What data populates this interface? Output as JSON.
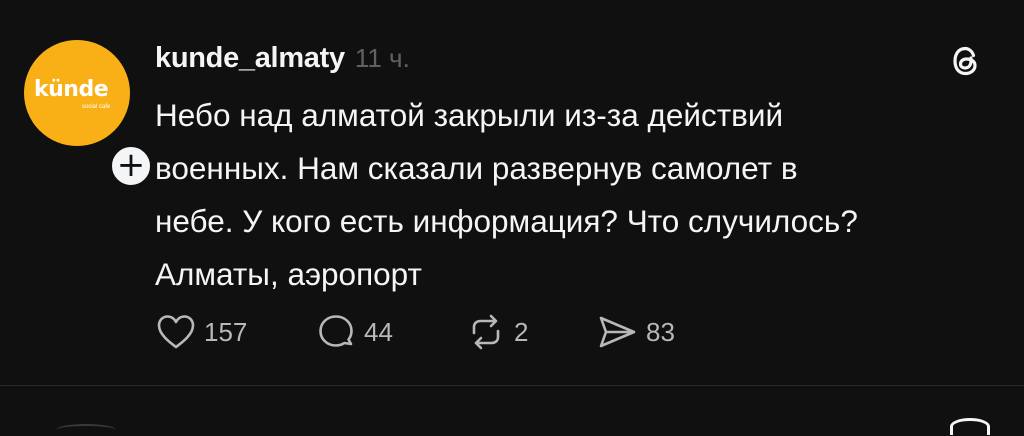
{
  "post": {
    "avatar": {
      "logo_text": "künde",
      "logo_subtext": "social cafe",
      "background_color": "#f8b016"
    },
    "follow_badge_symbol": "+",
    "username": "kunde_almaty",
    "timestamp": "11 ч.",
    "menu_icon": "threads-logo-icon",
    "text": "Небо над алматой закрыли из-за действий\nвоенных. Нам сказали развернув самолет в\nнебе. У кого есть информация? Что случилось?\nАлматы, аэропорт",
    "actions": {
      "like": {
        "icon": "heart-icon",
        "count": "157"
      },
      "comment": {
        "icon": "comment-icon",
        "count": "44"
      },
      "repost": {
        "icon": "repost-icon",
        "count": "2"
      },
      "share": {
        "icon": "send-icon",
        "count": "83"
      }
    }
  },
  "colors": {
    "background": "#101010",
    "text_primary": "#f3f5f7",
    "text_secondary": "#616161",
    "divider": "#2a2a2a"
  }
}
